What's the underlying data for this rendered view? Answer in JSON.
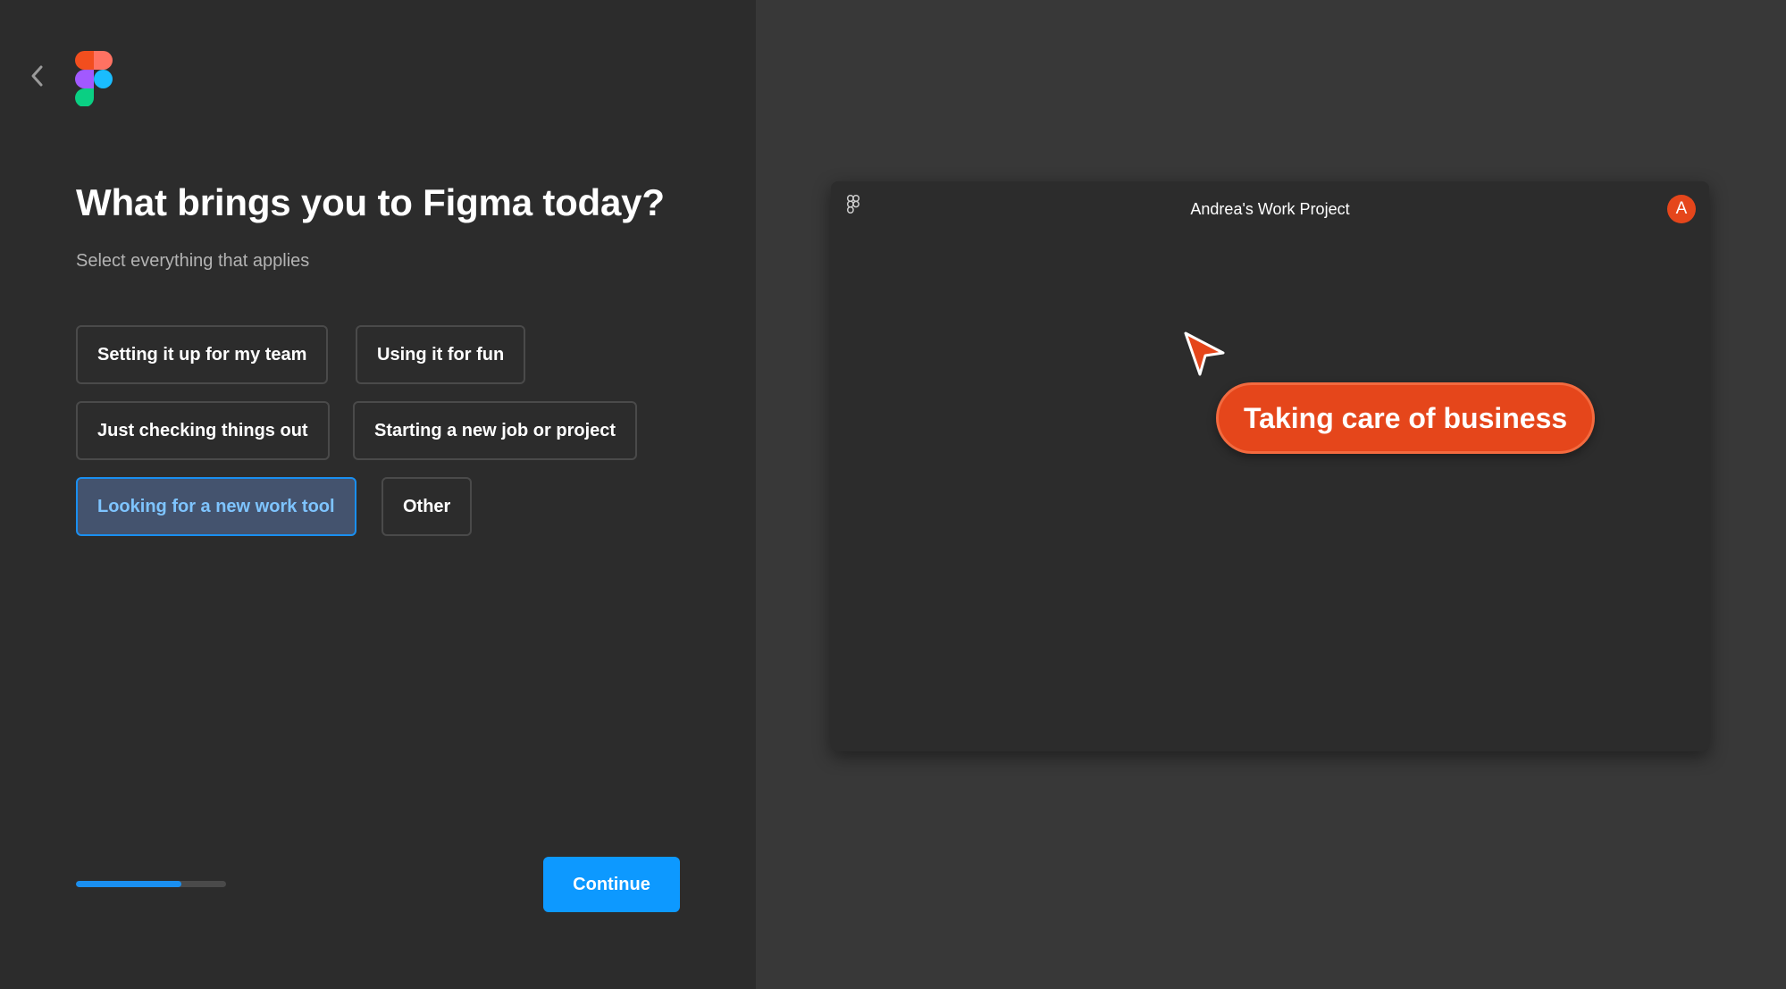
{
  "onboarding": {
    "heading": "What brings you to Figma today?",
    "subheading": "Select everything that applies",
    "options": [
      {
        "label": "Setting it up for my team",
        "selected": false
      },
      {
        "label": "Using it for fun",
        "selected": false
      },
      {
        "label": "Just checking things out",
        "selected": false
      },
      {
        "label": "Starting a new job or project",
        "selected": false
      },
      {
        "label": "Looking for a new work tool",
        "selected": true
      },
      {
        "label": "Other",
        "selected": false
      }
    ],
    "progress": 0.7,
    "continue_label": "Continue"
  },
  "preview": {
    "project_title": "Andrea's Work Project",
    "avatar_initial": "A",
    "cursor_label": "Taking care of business"
  },
  "colors": {
    "accent_blue": "#0d99ff",
    "cursor_orange": "#e5461b",
    "left_bg": "#2c2c2c",
    "right_bg": "#383838"
  }
}
